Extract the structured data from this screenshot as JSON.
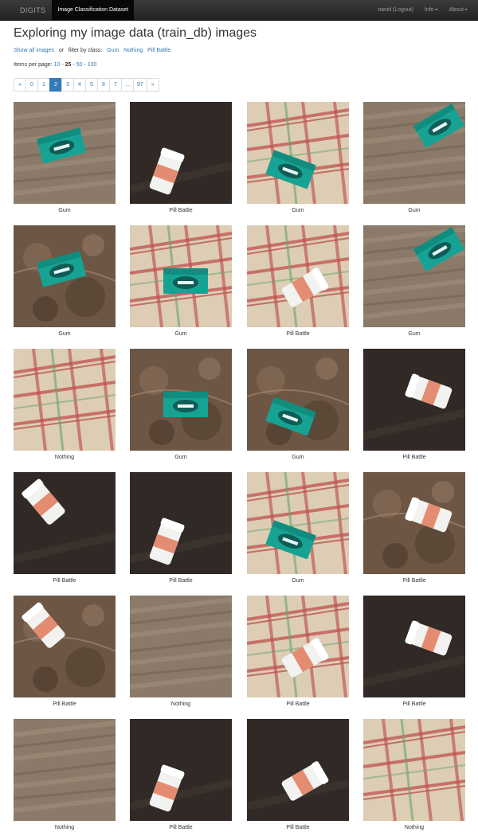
{
  "navbar": {
    "brand": "DIGITS",
    "active_tab": "Image Classification Dataset",
    "user_link": "navid (Logout)",
    "info_menu": "Info",
    "about_menu": "About"
  },
  "header": {
    "title": "Exploring my image data (train_db) images"
  },
  "filters": {
    "show_all": "Show all images",
    "or_text": "or",
    "filter_prefix": "filter by class:",
    "classes": [
      "Gum",
      "Nothing",
      "Pill Battle"
    ]
  },
  "per_page": {
    "label": "Items per page:",
    "options": [
      "10",
      "25",
      "50",
      "100"
    ],
    "selected": "25"
  },
  "pagination": {
    "pages": [
      "«",
      "0",
      "1",
      "2",
      "3",
      "4",
      "5",
      "6",
      "7",
      "...",
      "97",
      "»"
    ],
    "active": "2"
  },
  "images": [
    {
      "label": "Gum",
      "scene": "gum-table"
    },
    {
      "label": "Pill Battle",
      "scene": "pill-dark"
    },
    {
      "label": "Gum",
      "scene": "gum-cloth"
    },
    {
      "label": "Gum",
      "scene": "gum-table"
    },
    {
      "label": "Gum",
      "scene": "gum-granite"
    },
    {
      "label": "Gum",
      "scene": "gum-cloth"
    },
    {
      "label": "Pill Battle",
      "scene": "pill-cloth"
    },
    {
      "label": "Gum",
      "scene": "gum-table"
    },
    {
      "label": "Nothing",
      "scene": "cloth"
    },
    {
      "label": "Gum",
      "scene": "gum-granite"
    },
    {
      "label": "Gum",
      "scene": "gum-granite"
    },
    {
      "label": "Pill Battle",
      "scene": "pill-dark"
    },
    {
      "label": "Pill Battle",
      "scene": "pill-dark"
    },
    {
      "label": "Pill Battle",
      "scene": "pill-dark"
    },
    {
      "label": "Gum",
      "scene": "gum-cloth"
    },
    {
      "label": "Pill Battle",
      "scene": "pill-granite"
    },
    {
      "label": "Pill Battle",
      "scene": "pill-granite"
    },
    {
      "label": "Nothing",
      "scene": "table"
    },
    {
      "label": "Pill Battle",
      "scene": "pill-cloth"
    },
    {
      "label": "Pill Battle",
      "scene": "pill-dark"
    },
    {
      "label": "Nothing",
      "scene": "table"
    },
    {
      "label": "Pill Battle",
      "scene": "pill-dark"
    },
    {
      "label": "Pill Battle",
      "scene": "pill-dark"
    },
    {
      "label": "Nothing",
      "scene": "cloth"
    }
  ],
  "colors": {
    "navbar": "#222222",
    "link": "#337ab7",
    "active_page": "#337ab7",
    "table": "#8a7866",
    "cloth": "#d9c9ae",
    "dark_table": "#2a2522",
    "granite": "#6e5645",
    "gum_pack": "#1aa89a"
  }
}
